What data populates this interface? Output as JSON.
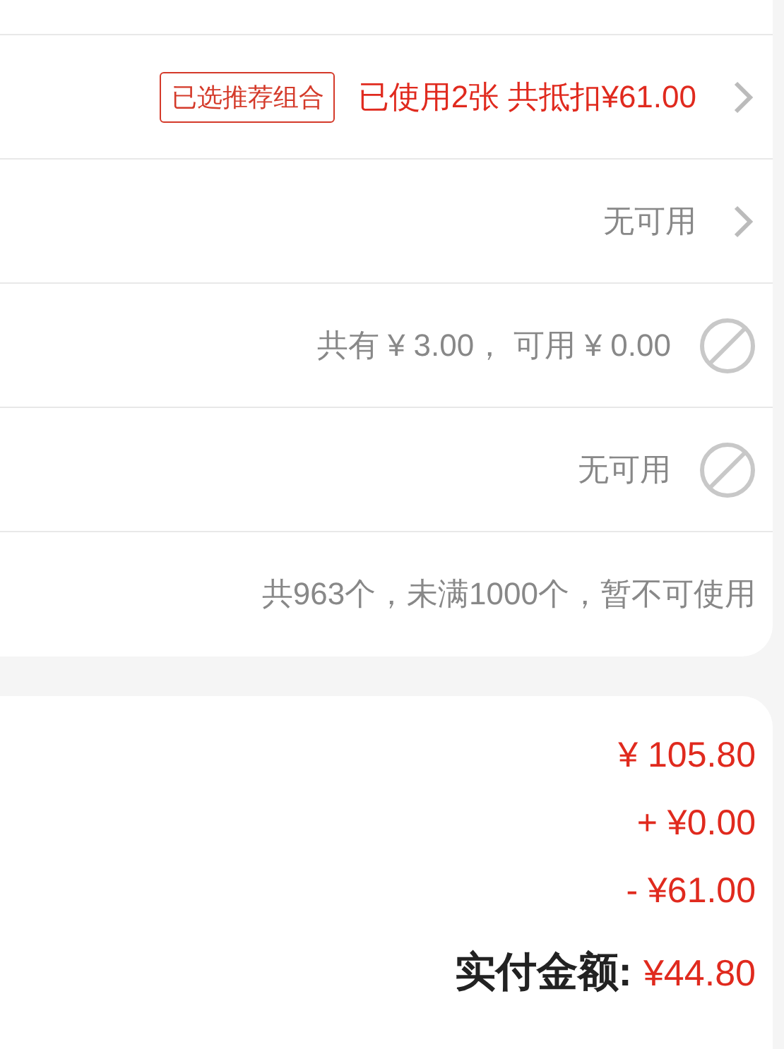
{
  "options": [
    {
      "tag": "已选推荐组合",
      "value": "已使用2张 共抵扣¥61.00",
      "highlight": true,
      "kind": "arrow"
    },
    {
      "value": "无可用",
      "highlight": false,
      "kind": "arrow"
    },
    {
      "value": "共有 ¥ 3.00， 可用 ¥ 0.00",
      "highlight": false,
      "kind": "disabled"
    },
    {
      "value": "无可用",
      "highlight": false,
      "kind": "disabled"
    },
    {
      "value": "共963个，未满1000个，暂不可使用",
      "highlight": false,
      "kind": "plain"
    }
  ],
  "summary": {
    "amounts": [
      "¥ 105.80",
      "+ ¥0.00",
      "- ¥61.00"
    ],
    "total_label": "实付金额:",
    "total_value": "¥44.80"
  }
}
